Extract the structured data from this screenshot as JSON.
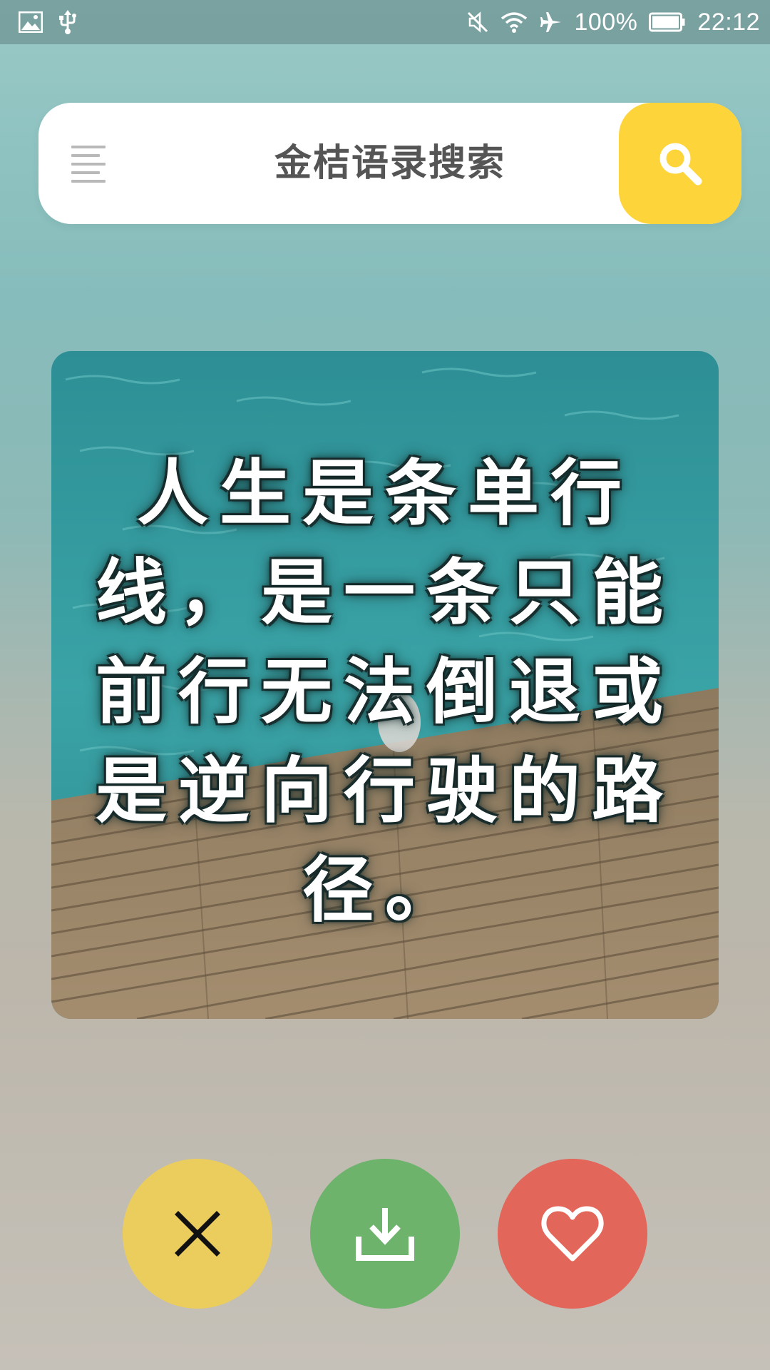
{
  "status_bar": {
    "battery_text": "100%",
    "time": "22:12",
    "icons": [
      "image-icon",
      "usb-icon",
      "mute-icon",
      "wifi-icon",
      "airplane-icon",
      "battery-icon"
    ]
  },
  "search_bar": {
    "title": "金桔语录搜索",
    "menu_icon": "menu-icon",
    "search_icon": "search-icon",
    "button_color": "#fdd43a"
  },
  "quote_card": {
    "lines": [
      "人生是条单行",
      "线，是一条只能",
      "前行无法倒退或",
      "是逆向行驶的路",
      "径。"
    ]
  },
  "actions": {
    "dismiss": {
      "icon": "close-icon",
      "color": "#ebcd5d"
    },
    "download": {
      "icon": "download-icon",
      "color": "#6db36c"
    },
    "favorite": {
      "icon": "heart-icon",
      "color": "#e2665a"
    }
  }
}
